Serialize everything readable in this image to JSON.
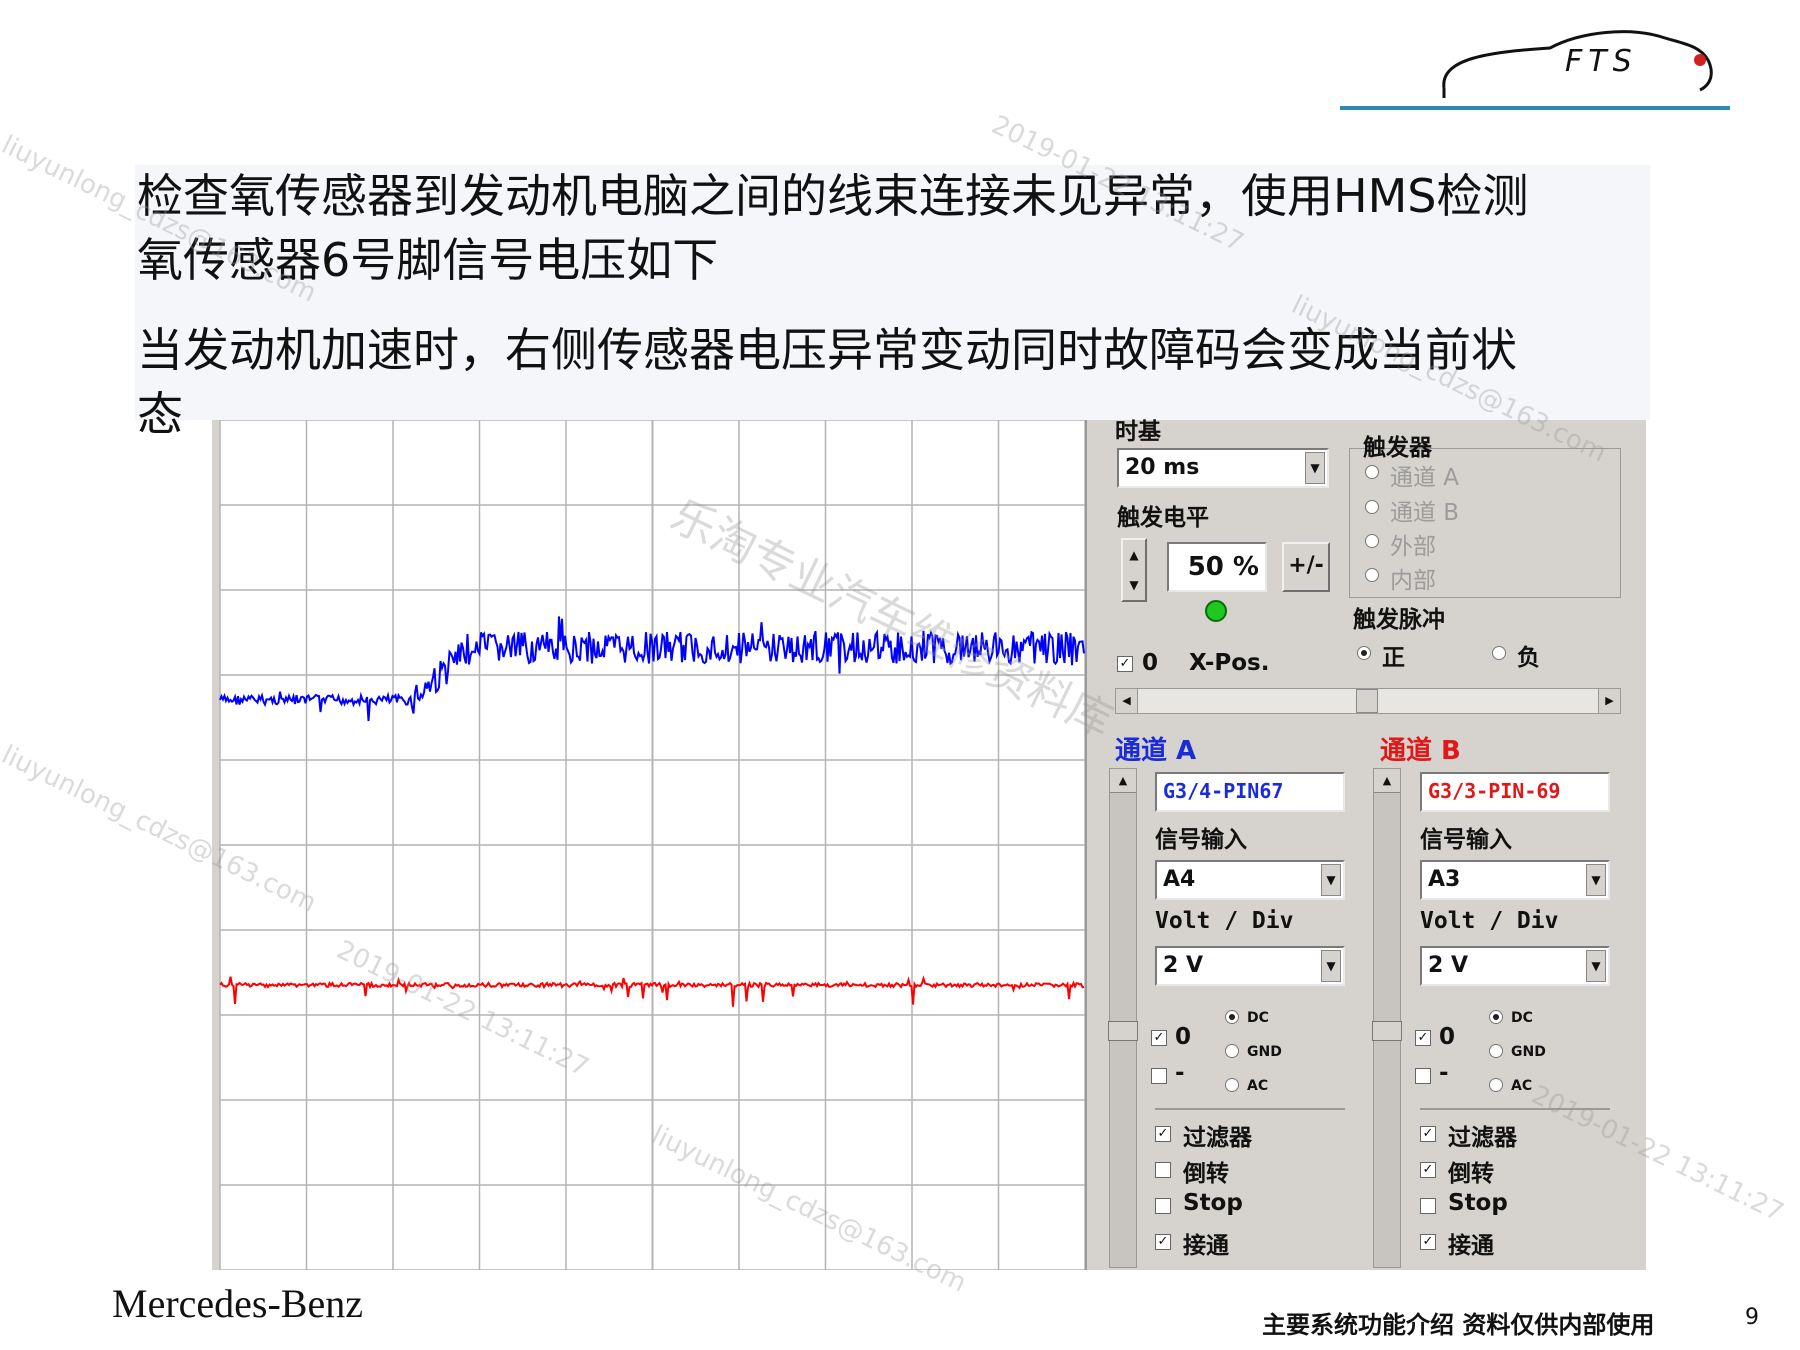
{
  "title": {
    "line1": "检查氧传感器到发动机电脑之间的线束连接未见异常，使用HMS检测",
    "line2": "氧传感器6号脚信号电压如下",
    "line3": "当发动机加速时，右侧传感器电压异常变动同时故障码会变成当前状",
    "line4": "态"
  },
  "logo": {
    "text": "FTS"
  },
  "scope": {
    "trace_a_color": "#0000ff",
    "trace_b_color": "#ff0000",
    "grid_color": "#b4b4b4"
  },
  "panel": {
    "timebase_label": "时基",
    "timebase_value": "20 ms",
    "trigger_level_label": "触发电平",
    "trigger_level_value": "50 %",
    "plus_minus_label": "+/-",
    "trigger_group_label": "触发器",
    "trigger_options": [
      "通道 A",
      "通道 B",
      "外部",
      "内部"
    ],
    "trigger_pulse_label": "触发脉冲",
    "pulse_positive": "正",
    "pulse_negative": "负",
    "xpos_check": "0",
    "xpos_label": "X-Pos.",
    "channel_a": {
      "title": "通道 A",
      "name": "G3/4-PIN67",
      "signal_input_label": "信号输入",
      "signal_input": "A4",
      "volt_div_label": "Volt / Div",
      "volt_div": "2 V",
      "zero_label": "0",
      "minus_label": "-",
      "coupling": [
        "DC",
        "GND",
        "AC"
      ],
      "filter_label": "过滤器",
      "invert_label": "倒转",
      "stop_label": "Stop",
      "connect_label": "接通",
      "color": "#1a2bd8"
    },
    "channel_b": {
      "title": "通道 B",
      "name": "G3/3-PIN-69",
      "signal_input_label": "信号输入",
      "signal_input": "A3",
      "volt_div_label": "Volt / Div",
      "volt_div": "2 V",
      "zero_label": "0",
      "minus_label": "-",
      "coupling": [
        "DC",
        "GND",
        "AC"
      ],
      "filter_label": "过滤器",
      "invert_label": "倒转",
      "stop_label": "Stop",
      "connect_label": "接通",
      "color": "#e01818"
    }
  },
  "footer": {
    "brand": "Mercedes-Benz",
    "note": "主要系统功能介绍  资料仅供内部使用",
    "page": "9"
  },
  "watermarks": [
    "liuyunlong_cdzs@163.com",
    "2019-01-22 13:11:27",
    "FTS",
    "乐淘专业汽车维修资料库"
  ]
}
